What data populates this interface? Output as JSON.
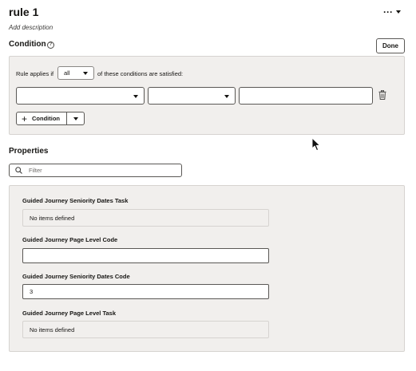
{
  "header": {
    "title": "rule 1",
    "description_placeholder": "Add description",
    "more_icon": "ellipsis-icon",
    "more_label": "···"
  },
  "condition": {
    "title": "Condition",
    "help_icon": "question-circle-icon",
    "help_glyph": "?",
    "done_label": "Done",
    "rule_applies_label": "Rule applies if",
    "match_value": "all",
    "match_suffix": "of these conditions are satisfied:",
    "row": {
      "field": "",
      "operator": "",
      "value": "",
      "delete_icon": "trash-icon"
    },
    "add_button_label": "Condition",
    "add_icon": "plus-icon",
    "add_glyph": "+"
  },
  "properties": {
    "title": "Properties",
    "filter_placeholder": "Filter",
    "filter_value": "",
    "items": [
      {
        "label": "Guided Journey Seniority Dates Task",
        "value": "No items defined",
        "editable": false
      },
      {
        "label": "Guided Journey Page Level Code",
        "value": "",
        "editable": true
      },
      {
        "label": "Guided Journey Seniority Dates Code",
        "value": "3",
        "editable": true
      },
      {
        "label": "Guided Journey Page Level Task",
        "value": "No items defined",
        "editable": false
      }
    ]
  },
  "colors": {
    "panel_bg": "#f1efed",
    "panel_border": "#d6d3d0",
    "text": "#161513",
    "input_border": "#5a5855"
  }
}
